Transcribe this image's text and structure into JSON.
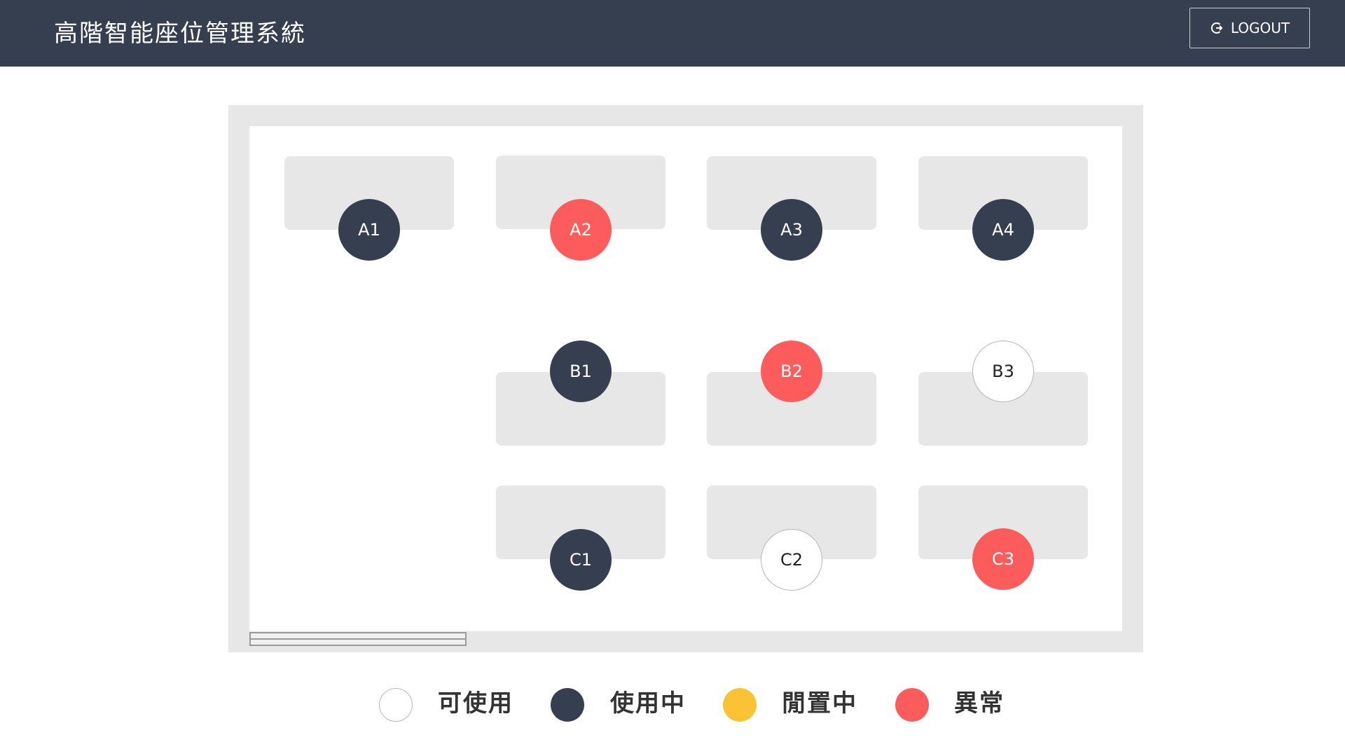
{
  "header": {
    "title": "高階智能座位管理系統",
    "logout_label": "LOGOUT",
    "logout_icon": "logout-icon"
  },
  "colors": {
    "header_bg": "#363f4f",
    "available": "#ffffff",
    "in_use": "#363f4f",
    "idle": "#fcc236",
    "abnormal": "#fd5c5c"
  },
  "seats": [
    {
      "id": "A1",
      "label": "A1",
      "status": "in_use"
    },
    {
      "id": "A2",
      "label": "A2",
      "status": "abnormal"
    },
    {
      "id": "A3",
      "label": "A3",
      "status": "in_use"
    },
    {
      "id": "A4",
      "label": "A4",
      "status": "in_use"
    },
    {
      "id": "B1",
      "label": "B1",
      "status": "in_use"
    },
    {
      "id": "B2",
      "label": "B2",
      "status": "abnormal"
    },
    {
      "id": "B3",
      "label": "B3",
      "status": "available"
    },
    {
      "id": "C1",
      "label": "C1",
      "status": "in_use"
    },
    {
      "id": "C2",
      "label": "C2",
      "status": "available"
    },
    {
      "id": "C3",
      "label": "C3",
      "status": "abnormal"
    }
  ],
  "legend": [
    {
      "status": "available",
      "label": "可使用"
    },
    {
      "status": "in_use",
      "label": "使用中"
    },
    {
      "status": "idle",
      "label": "閒置中"
    },
    {
      "status": "abnormal",
      "label": "異常"
    }
  ]
}
